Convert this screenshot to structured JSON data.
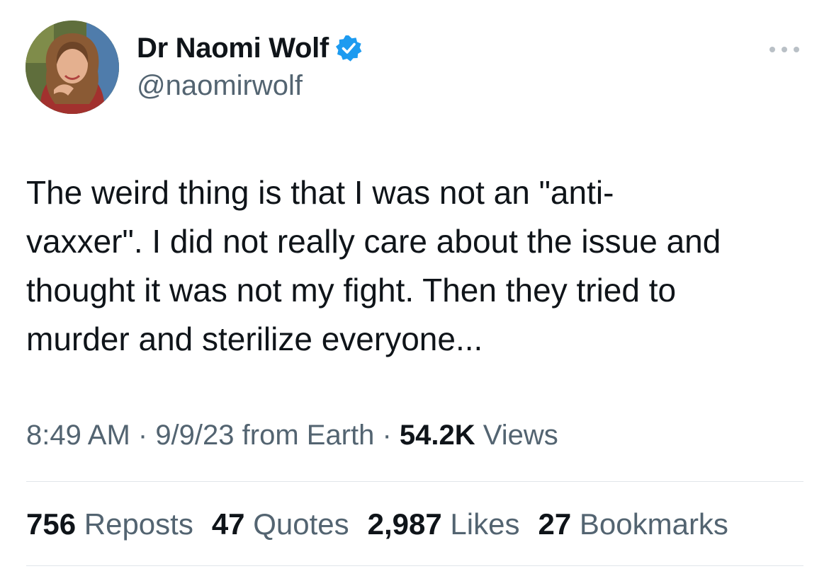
{
  "author": {
    "display_name": "Dr Naomi Wolf",
    "handle": "@naomirwolf",
    "verified_icon": "verified-badge-icon",
    "verified_color": "#1d9bf0"
  },
  "tweet": {
    "lines": [
      "The weird thing is that I was not an \"anti-",
      "vaxxer\". I did not really care about the issue and",
      "thought it was not my fight. Then they tried to",
      "murder and sterilize everyone..."
    ]
  },
  "meta": {
    "time": "8:49 AM",
    "sep1": " · ",
    "date": "9/9/23",
    "source": " from Earth",
    "sep2": " · ",
    "views_count": "54.2K",
    "views_label": " Views"
  },
  "stats": [
    {
      "count": "756",
      "label": "Reposts"
    },
    {
      "count": "47",
      "label": "Quotes"
    },
    {
      "count": "2,987",
      "label": "Likes"
    },
    {
      "count": "27",
      "label": "Bookmarks"
    }
  ],
  "icons": {
    "more": "more-options-icon"
  },
  "colors": {
    "text_primary": "#0f1419",
    "text_secondary": "#536471",
    "divider": "#e1e6ea"
  }
}
